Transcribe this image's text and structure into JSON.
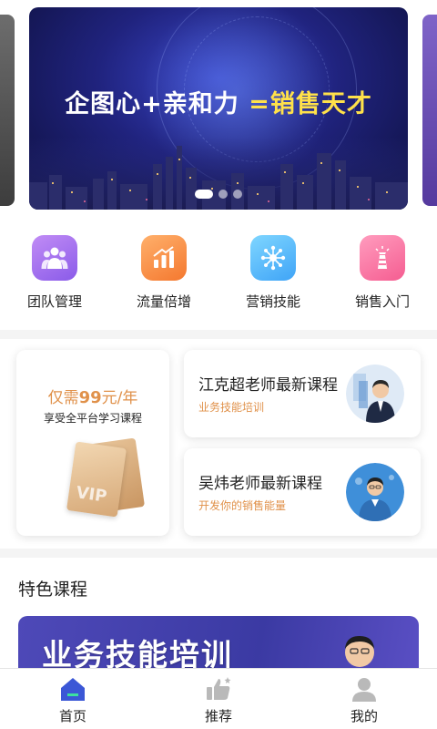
{
  "banner": {
    "title_main": "企图心+亲和力 ",
    "title_highlight": "=销售天才",
    "slide_count": 3,
    "active_slide": 1
  },
  "categories": [
    {
      "label": "团队管理",
      "icon": "team-icon",
      "color_from": "#c18cf5",
      "color_to": "#8a5be9"
    },
    {
      "label": "流量倍增",
      "icon": "bar-chart-icon",
      "color_from": "#ffb06b",
      "color_to": "#f4782f"
    },
    {
      "label": "营销技能",
      "icon": "network-icon",
      "color_from": "#7fd6ff",
      "color_to": "#3fa4f7"
    },
    {
      "label": "销售入门",
      "icon": "lighthouse-icon",
      "color_from": "#ff9cbe",
      "color_to": "#f55d91"
    }
  ],
  "promo": {
    "vip": {
      "price_prefix": "仅需",
      "price_amount": "99",
      "price_suffix": "元/年",
      "desc": "享受全平台学习课程",
      "card_text": "VIP"
    },
    "courses": [
      {
        "title": "江克超老师最新课程",
        "subtitle": "业务技能培训"
      },
      {
        "title": "吴炜老师最新课程",
        "subtitle": "开发你的销售能量"
      }
    ]
  },
  "section": {
    "title": "特色课程",
    "featured_title": "业务技能培训"
  },
  "tabbar": {
    "tabs": [
      {
        "label": "首页",
        "icon": "home-icon",
        "active": true
      },
      {
        "label": "推荐",
        "icon": "thumbs-up-icon",
        "active": false
      },
      {
        "label": "我的",
        "icon": "user-icon",
        "active": false
      }
    ]
  },
  "colors": {
    "accent_orange": "#e0914a",
    "home_active": "#3b57d6",
    "tab_inactive": "#b9b9b9"
  }
}
